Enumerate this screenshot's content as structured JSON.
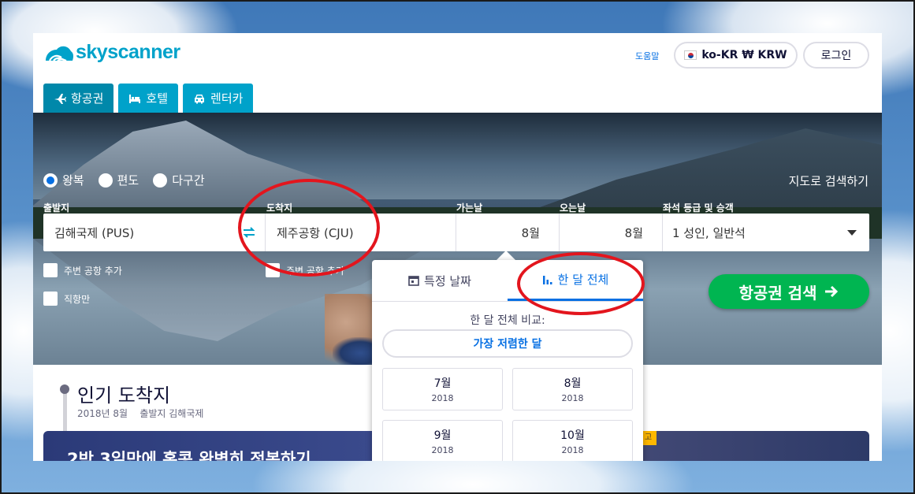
{
  "brand": {
    "name": "skyscanner"
  },
  "header": {
    "help": "도움말",
    "locale": "ko-KR ₩ KRW",
    "login": "로그인"
  },
  "tabs": [
    {
      "label": "항공권",
      "icon": "airplane-icon"
    },
    {
      "label": "호텔",
      "icon": "bed-icon"
    },
    {
      "label": "렌터카",
      "icon": "car-icon"
    }
  ],
  "search": {
    "trip_types": [
      "왕복",
      "편도",
      "다구간"
    ],
    "selected_trip_type": "왕복",
    "map_search": "지도로 검색하기",
    "labels": {
      "origin": "출발지",
      "destination": "도착지",
      "depart": "가는날",
      "return": "오는날",
      "cabin": "좌석 등급 및 승객"
    },
    "values": {
      "origin": "김해국제 (PUS)",
      "destination": "제주공항 (CJU)",
      "depart": "8월",
      "return": "8월",
      "cabin": "1 성인, 일반석"
    },
    "checkboxes": {
      "nearby_origin": "주변 공항 추가",
      "nearby_dest": "주변 공항 추가",
      "direct_only": "직항만"
    },
    "submit": "항공권 검색"
  },
  "calendar_popup": {
    "tab_specific": "특정 날짜",
    "tab_whole_month": "한 달 전체",
    "compare_label": "한 달 전체 비교:",
    "cheapest": "가장 저렴한 달",
    "months": [
      {
        "month": "7월",
        "year": "2018"
      },
      {
        "month": "8월",
        "year": "2018"
      },
      {
        "month": "9월",
        "year": "2018"
      },
      {
        "month": "10월",
        "year": "2018"
      }
    ]
  },
  "popular": {
    "title": "인기 도착지",
    "subtitle": "2018년 8월    출발지 김해국제",
    "promo_text": "2박 3일만에 홍콩 완벽히 정복하기",
    "promo_badge": "고"
  },
  "colors": {
    "brand": "#00a2ca",
    "accent": "#0770e3",
    "cta": "#00b551",
    "annotation": "#e3151d"
  }
}
